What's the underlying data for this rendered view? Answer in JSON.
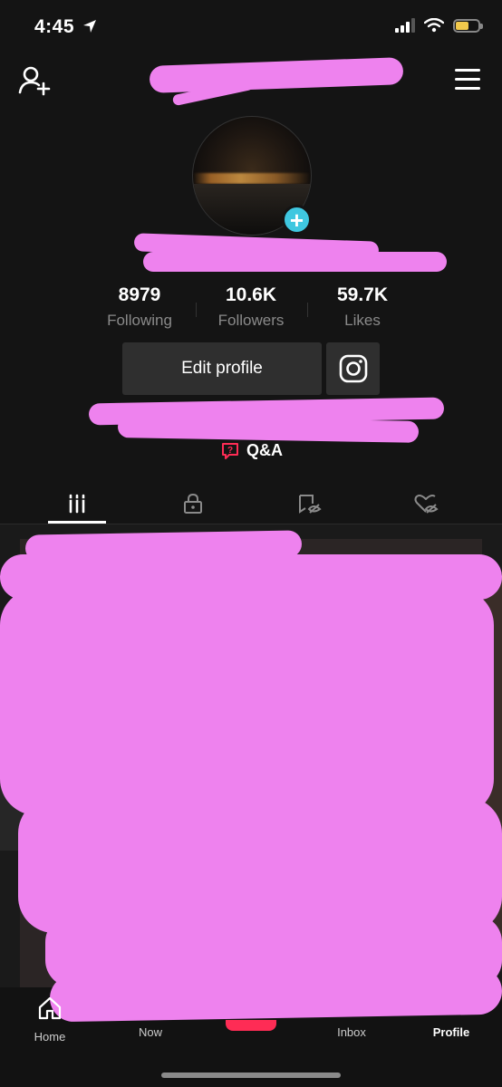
{
  "status_bar": {
    "time": "4:45"
  },
  "profile": {
    "stats": [
      {
        "value": "8979",
        "label": "Following"
      },
      {
        "value": "10.6K",
        "label": "Followers"
      },
      {
        "value": "59.7K",
        "label": "Likes"
      }
    ],
    "edit_profile_label": "Edit profile",
    "qa_label": "Q&A"
  },
  "nav": {
    "items": [
      {
        "label": "Home"
      },
      {
        "label": "Now"
      },
      {
        "label": ""
      },
      {
        "label": "Inbox"
      },
      {
        "label": "Profile"
      }
    ],
    "active": "Profile"
  },
  "colors": {
    "background": "#141414",
    "redaction": "#ee82ee",
    "badge": "#3fc7e0",
    "qa_accent": "#fe2c55"
  },
  "icons": [
    "add-user-icon",
    "menu-icon",
    "instagram-icon",
    "question-bubble-icon",
    "grid-icon",
    "lock-icon",
    "repost-icon",
    "liked-hidden-icon",
    "home-icon",
    "create-icon",
    "inbox-icon",
    "profile-icon"
  ]
}
